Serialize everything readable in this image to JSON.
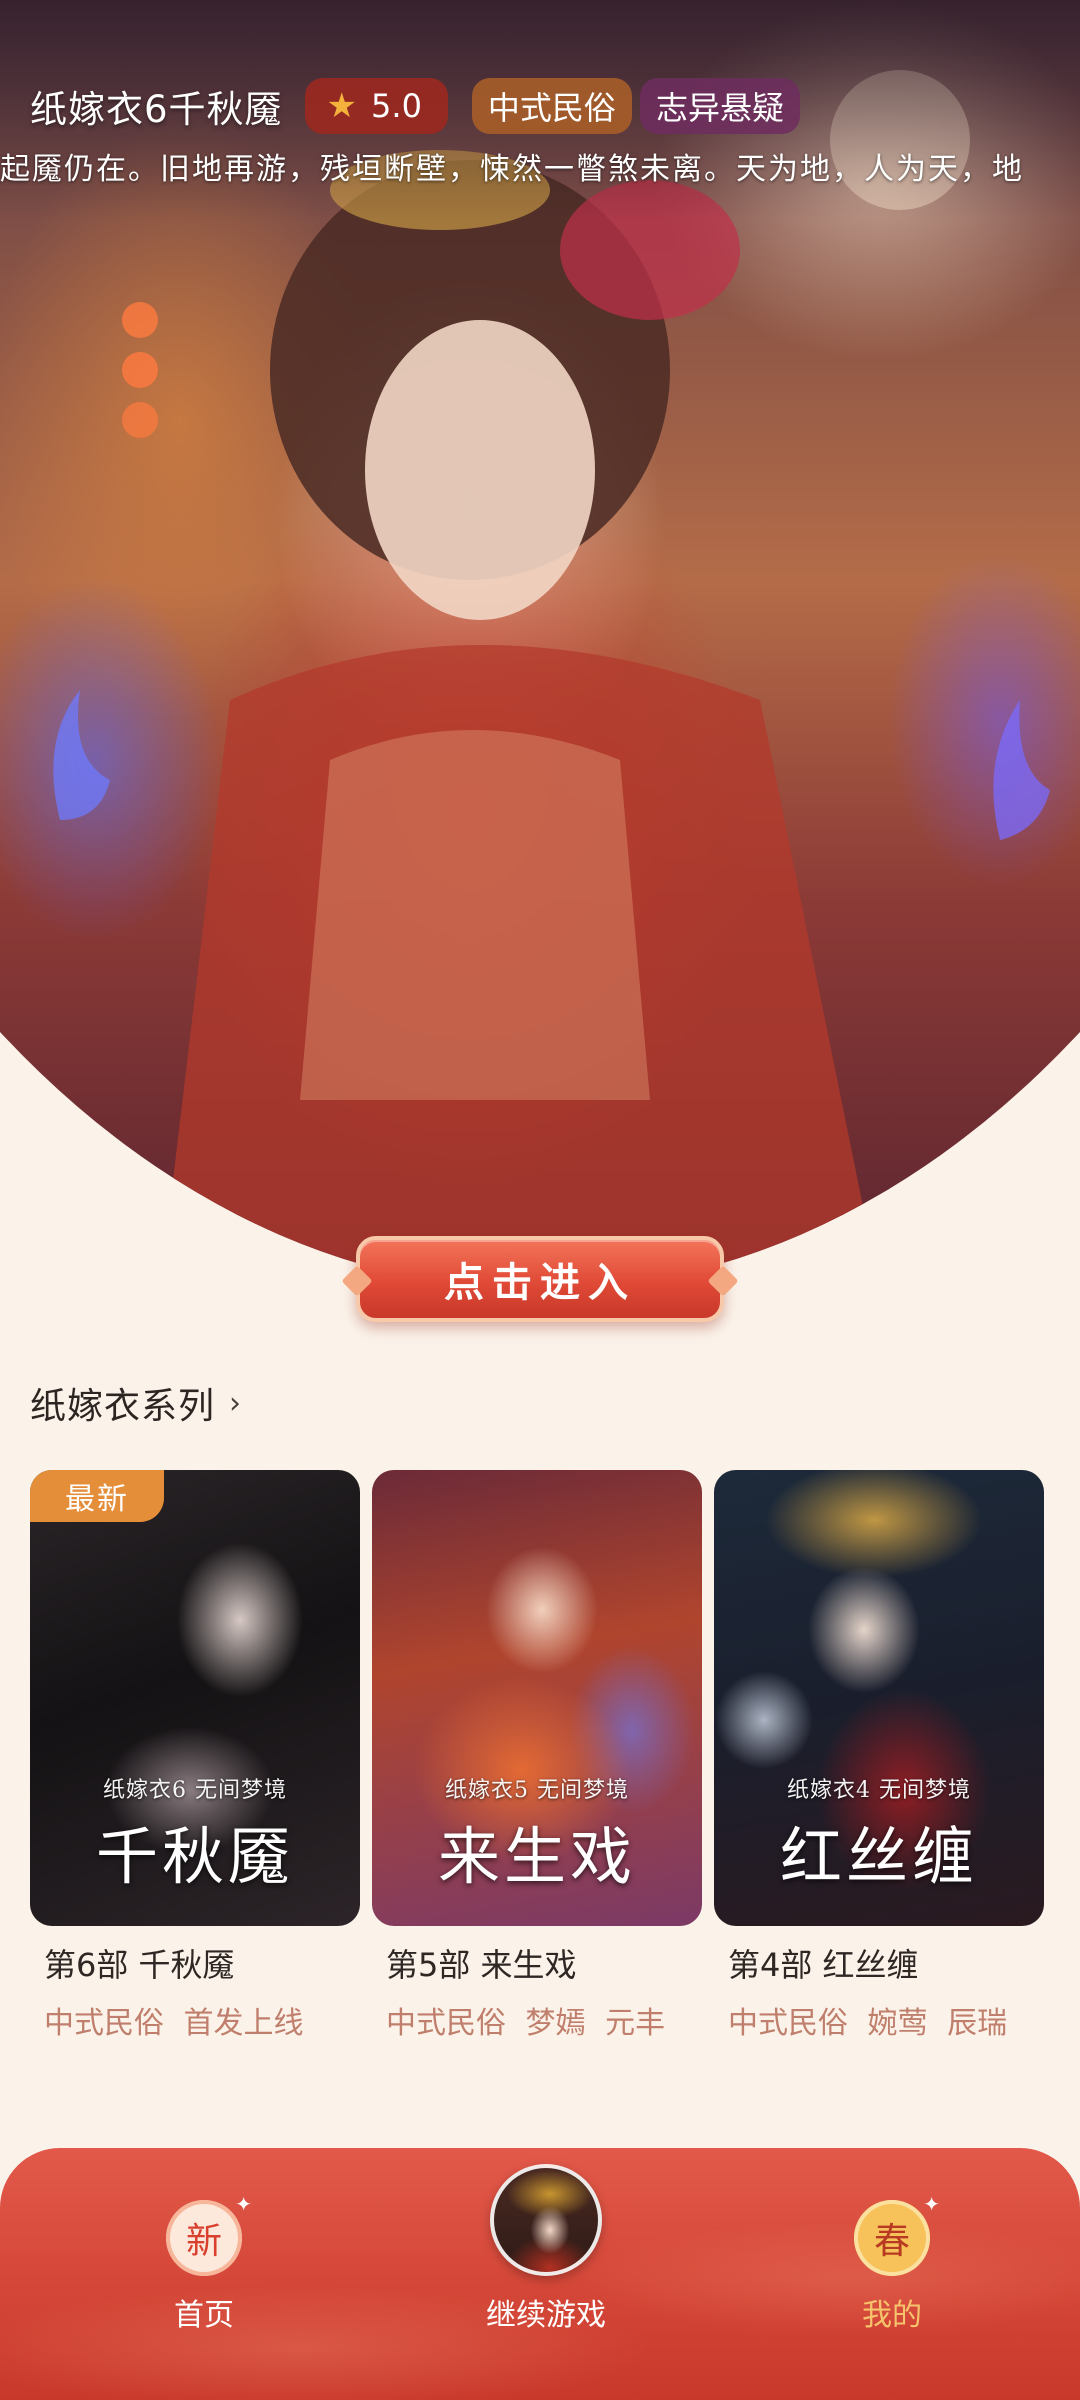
{
  "hero": {
    "title": "纸嫁衣6千秋魇",
    "rating": "5.0",
    "tags": [
      "中式民俗",
      "志异悬疑"
    ],
    "marquee": "起魇仍在。旧地再游，残垣断壁，悚然一瞥煞未离。天为地，人为天，地",
    "enter_label": "点击进入"
  },
  "series": {
    "title": "纸嫁衣系列",
    "cards": [
      {
        "badge": "最新",
        "cover_caption": "纸嫁衣6 无间梦境",
        "cover_title": "千秋魇",
        "name": "第6部 千秋魇",
        "tags": [
          "中式民俗",
          "首发上线"
        ]
      },
      {
        "badge": "",
        "cover_caption": "纸嫁衣5 无间梦境",
        "cover_title": "来生戏",
        "name": "第5部 来生戏",
        "tags": [
          "中式民俗",
          "梦嫣",
          "元丰"
        ]
      },
      {
        "badge": "",
        "cover_caption": "纸嫁衣4 无间梦境",
        "cover_title": "红丝缠",
        "name": "第4部 红丝缠",
        "tags": [
          "中式民俗",
          "婉莺",
          "辰瑞"
        ]
      }
    ]
  },
  "nav": {
    "home_icon": "新",
    "home_label": "首页",
    "continue_label": "继续游戏",
    "mine_icon": "春",
    "mine_label": "我的"
  },
  "icons": {
    "star": "star-icon",
    "chevron": "chevron-right-icon",
    "home": "home-seal-icon",
    "mine": "spring-seal-icon"
  },
  "colors": {
    "accent_red": "#d34536",
    "badge_orange": "#e58e3a",
    "tag_text": "#c07f6c",
    "page_bg": "#fbf3ea"
  }
}
